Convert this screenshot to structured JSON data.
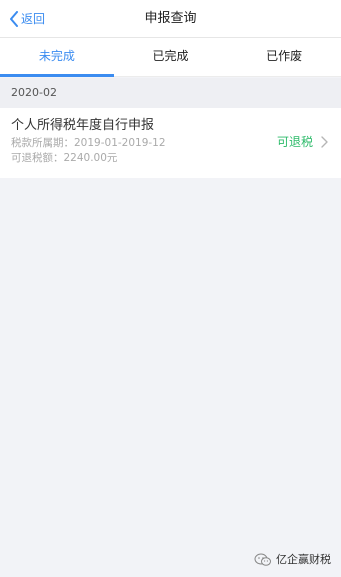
{
  "header": {
    "back_label": "返回",
    "title": "申报查询"
  },
  "tabs": [
    {
      "label": "未完成",
      "active": true
    },
    {
      "label": "已完成",
      "active": false
    },
    {
      "label": "已作废",
      "active": false
    }
  ],
  "group": {
    "label": "2020-02"
  },
  "record": {
    "title": "个人所得税年度自行申报",
    "period": "税款所属期：2019-01-2019-12",
    "refund": "可退税额：2240.00元",
    "status": "可退税"
  },
  "watermark": {
    "text": "亿企赢财税"
  },
  "colors": {
    "accent": "#3b8cf0",
    "status": "#2dbb6a",
    "background": "#f2f3f7"
  }
}
